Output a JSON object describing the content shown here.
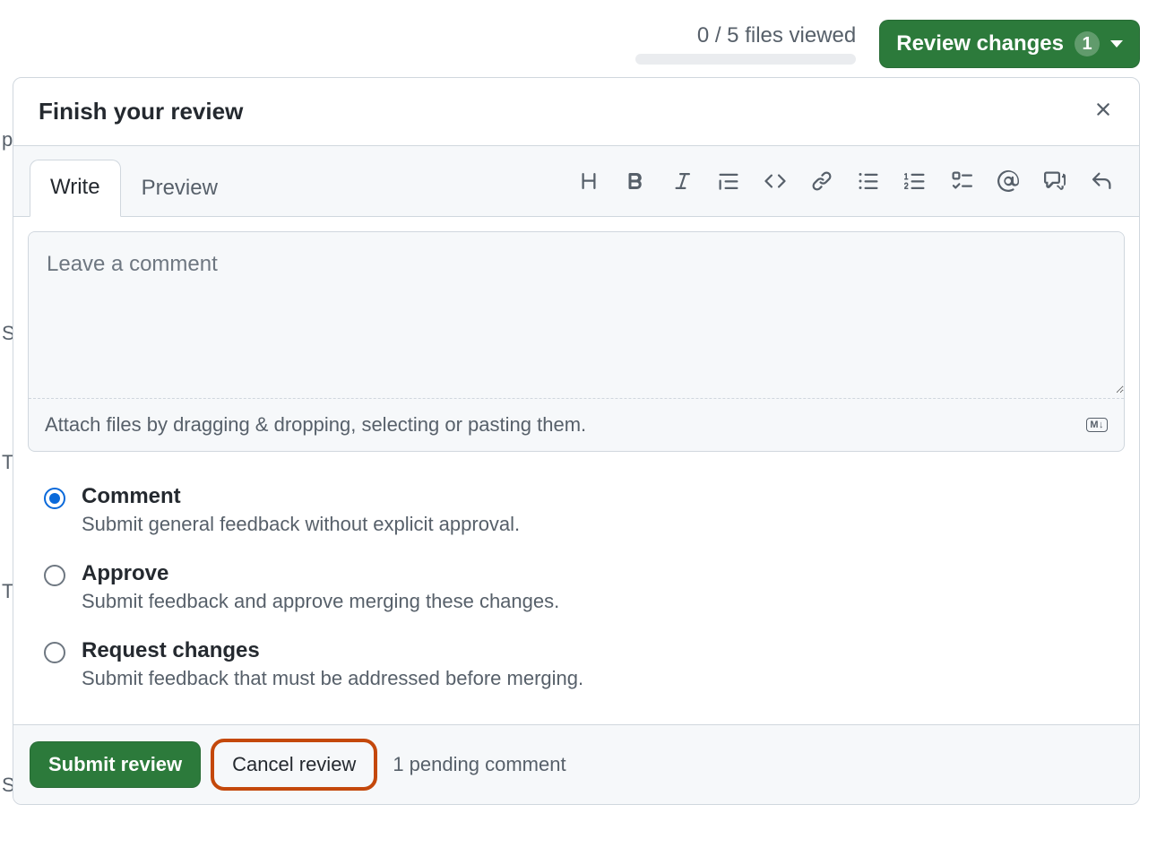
{
  "bg_letters": [
    "p",
    "",
    "",
    "S",
    "",
    "T",
    "",
    "T",
    "",
    "",
    "S",
    ""
  ],
  "topbar": {
    "files_viewed": "0 / 5 files viewed",
    "review_button": "Review changes",
    "review_count": "1"
  },
  "panel": {
    "title": "Finish your review",
    "tabs": {
      "write": "Write",
      "preview": "Preview"
    },
    "toolbar_icons": [
      "heading",
      "bold",
      "italic",
      "quote",
      "code",
      "link",
      "unordered-list",
      "ordered-list",
      "task-list",
      "mention",
      "cross-reference",
      "reply"
    ],
    "comment_placeholder": "Leave a comment",
    "attach_hint": "Attach files by dragging & dropping, selecting or pasting them.",
    "markdown_badge": "M↓",
    "options": [
      {
        "key": "comment",
        "title": "Comment",
        "desc": "Submit general feedback without explicit approval.",
        "checked": true
      },
      {
        "key": "approve",
        "title": "Approve",
        "desc": "Submit feedback and approve merging these changes.",
        "checked": false
      },
      {
        "key": "request",
        "title": "Request changes",
        "desc": "Submit feedback that must be addressed before merging.",
        "checked": false
      }
    ],
    "submit_label": "Submit review",
    "cancel_label": "Cancel review",
    "pending_text": "1 pending comment"
  }
}
